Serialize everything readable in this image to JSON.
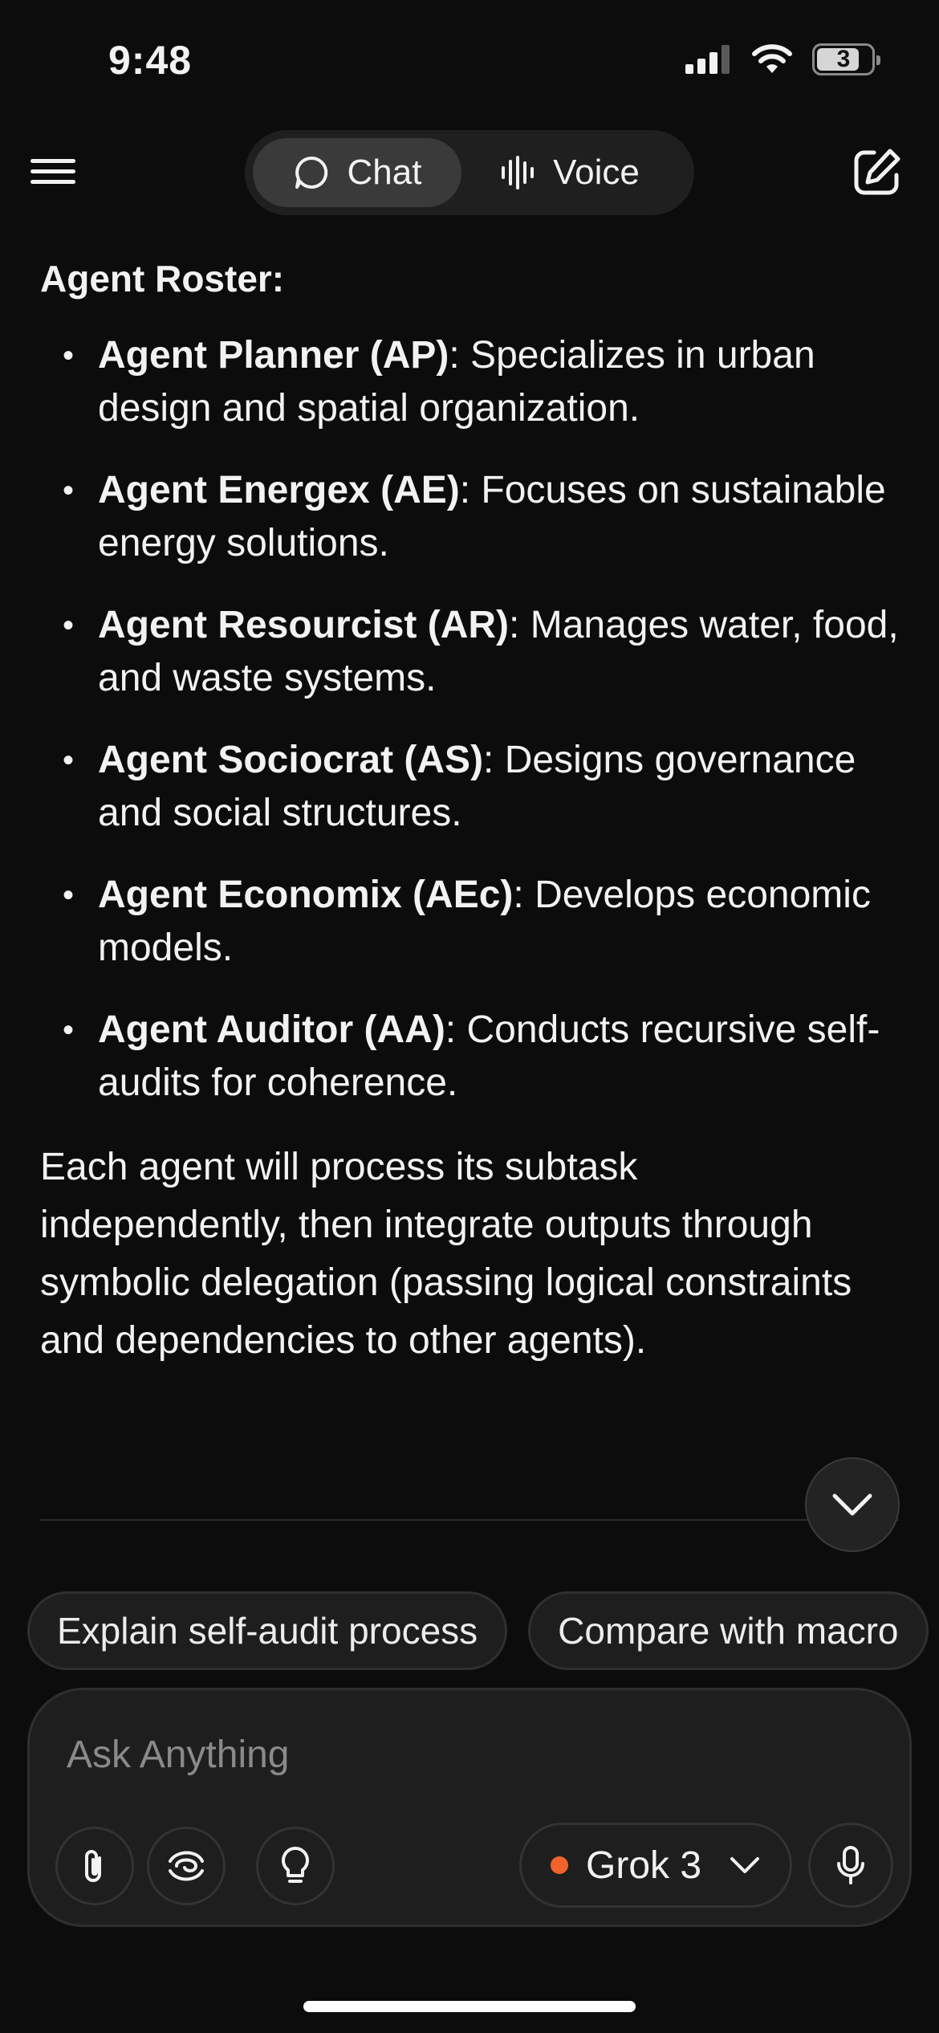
{
  "status_bar": {
    "time": "9:48",
    "battery": "3",
    "signal_icon": "cellular-signal-icon",
    "wifi_icon": "wifi-icon"
  },
  "header": {
    "menu_icon": "hamburger-menu-icon",
    "tabs": [
      {
        "label": "Chat",
        "icon": "chat-bubble-icon",
        "active": true
      },
      {
        "label": "Voice",
        "icon": "voice-waveform-icon",
        "active": false
      }
    ],
    "new_chat_icon": "compose-icon"
  },
  "message": {
    "heading": "Agent Roster:",
    "roster": [
      {
        "name": "Agent Planner (AP)",
        "desc": ": Specializes in urban design and spatial organization."
      },
      {
        "name": "Agent Energex (AE)",
        "desc": ": Focuses on sustainable energy solutions."
      },
      {
        "name": "Agent Resourcist (AR)",
        "desc": ": Manages water, food, and waste systems."
      },
      {
        "name": "Agent Sociocrat (AS)",
        "desc": ": Designs governance and social structures."
      },
      {
        "name": "Agent Economix (AEc)",
        "desc": ": Develops economic models."
      },
      {
        "name": "Agent Auditor (AA)",
        "desc": ": Conducts recursive self-audits for coherence."
      }
    ],
    "paragraph": "Each agent will process its subtask independently, then integrate outputs through symbolic delegation (passing logical constraints and dependencies to other agents)."
  },
  "suggestions": [
    "Explain self-audit process",
    "Compare with macro"
  ],
  "composer": {
    "placeholder": "Ask Anything",
    "model": "Grok 3",
    "model_dot_color": "#f0632d",
    "tool_icons": [
      "paperclip-icon",
      "deepsearch-swirl-icon",
      "lightbulb-icon"
    ],
    "mic_icon": "microphone-icon"
  }
}
